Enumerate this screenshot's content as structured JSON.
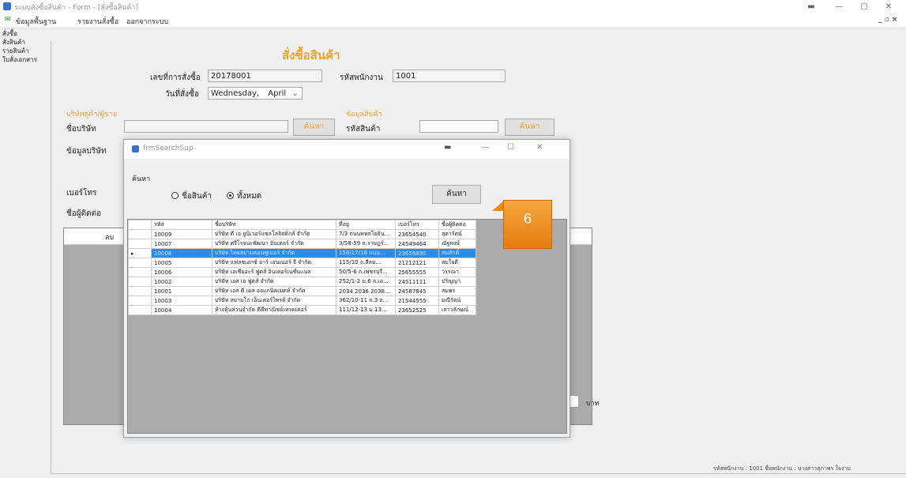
{
  "window": {
    "title": "ระบบสั่งซื้อสินค้า - Form - [สั่งซื้อสินค้า]",
    "controls": [
      "minimize",
      "maximize",
      "close"
    ],
    "mdi_controls": "_ ▫ ×"
  },
  "menu": [
    "ข้อมูลพื้นฐาน",
    "รายงานสั่งซื้อ",
    "ออกจากระบบ"
  ],
  "sidebar": [
    "สั่งซื้อ",
    "สั่งสินค้า",
    "รายสินค้า",
    "ใบสั่งเอกสาร"
  ],
  "form": {
    "title": "สั่งซื้อสินค้า",
    "order_no_label": "เลขที่การสั่งซื้อ",
    "order_no": "20178001",
    "employee_label": "รหัสพนักงาน",
    "employee": "1001",
    "date_label": "วันที่สั่งซื้อ",
    "date_day": "Wednesday,",
    "date_month": "April",
    "vendor_section": "บริษัทคู่ค้า/ผู้ขาย",
    "product_section": "ข้อมูลสินค้า",
    "company_label": "ชื่อบริษัท",
    "search_btn": "ค้นหา",
    "product_id_label": "รหัสสินค้า",
    "contact_label": "ข้อมูลบริษัท",
    "phone_label": "เบอร์โทร",
    "contact2_label": "ชื่อผู้ติดต่อ",
    "grid_no": "ลบ",
    "baht": "บาท",
    "status": "รหัสพนักงาน : 1001   ชื่อพนักงาน : นางสาวสุภาพร ใจงาม"
  },
  "dialog": {
    "title": "frmSearchSup",
    "search_label": "ค้นหา",
    "radio_name": "ชื่อสินค้า",
    "radio_all": "ทั้งหมด",
    "search_btn": "ค้นหา",
    "columns": [
      "รหัส",
      "ชื่อบริษัท",
      "ที่อยู่",
      "เบอร์โทร",
      "ชื่อผู้ติดต่อ"
    ],
    "rows": [
      [
        "10009",
        "บริษัท ดี เอ ยูนิเวอร์แซลโลจิสติกส์ จำกัด",
        "7/3 ถนนพหลโยธิน...",
        "23654540",
        "สุดารัตน์"
      ],
      [
        "10007",
        "บริษัท ศรีโรจนะพัฒนา อินเตอร์ จำกัด",
        "3/58-59 ถ.ราษฎร์...",
        "24549464",
        "ณัฐพงษ์"
      ],
      [
        "10008",
        "บริษัท ไทยสยามคอนซูเมอร์ จำกัด",
        "158/17/18 ถนน...",
        "23658895",
        "สมศักดิ์"
      ],
      [
        "10005",
        "บริษัท แฟลชเอกซ์ อาร์ เอนเนอร์ จี จำกัด",
        "115/10 ถ.สีลม...",
        "21212121",
        "สมใจดี"
      ],
      [
        "10006",
        "บริษัท เอเชียอะร์ ฟูดส์ อินเตอร์เนชั่นแนล",
        "50/5-6 ถ.เพชรบุรี...",
        "25655555",
        "วรรณา"
      ],
      [
        "10002",
        "บริษัท เอส เอ ฟูดส์ จำกัด",
        "252/1-2 ม.6 ถ.เอ...",
        "24511111",
        "ปริญญา"
      ],
      [
        "10001",
        "บริษัท เอส ดี เอส ออแกนิคเมตท์ จำกัด",
        "2034 2036 2038...",
        "24587845",
        "สมพร"
      ],
      [
        "10003",
        "บริษัท สยามโก เอ็นเตอร์ไพรส์ จำกัด",
        "362/10-11 ถ.3 ถ...",
        "21544555",
        "มณีรัตน์"
      ],
      [
        "10004",
        "ห้างหุ้นส่วนจำกัด ดีดีพาณิชย์เทรดเดอร์",
        "111/12-13 ม.13...",
        "23652525",
        "เสาวลักษณ์"
      ]
    ],
    "selected_row": 2
  },
  "callout": {
    "number": "6"
  }
}
